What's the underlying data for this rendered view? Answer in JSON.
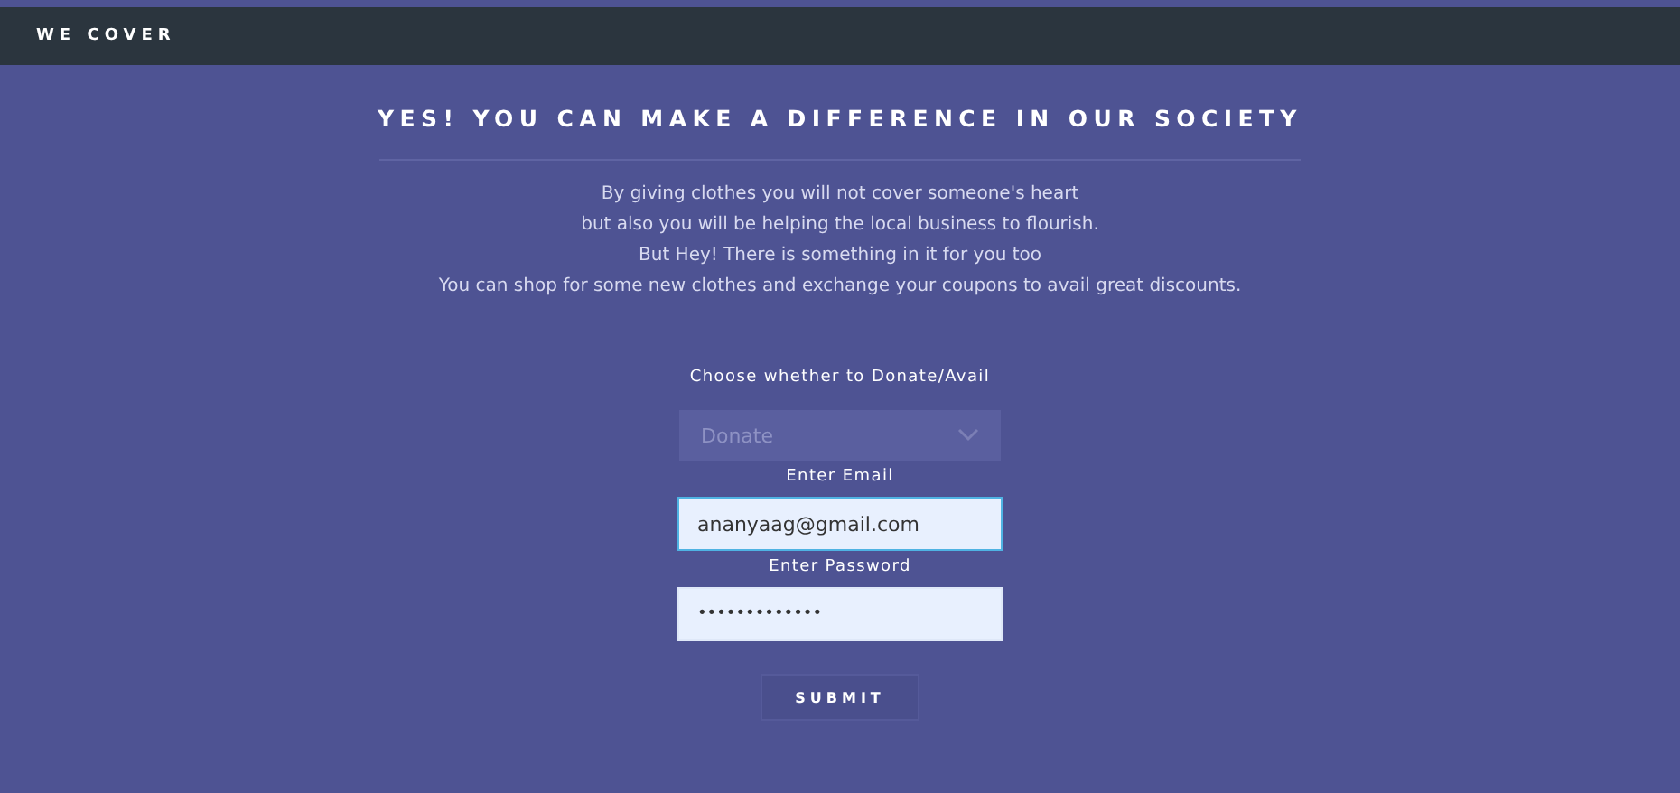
{
  "header": {
    "brand": "WE COVER"
  },
  "heading": "YES! YOU CAN MAKE A DIFFERENCE IN OUR SOCIETY",
  "intro": [
    "By giving clothes you will not cover someone's heart",
    "but also you will be helping the local business to flourish.",
    "But Hey! There is something in it for you too",
    "You can shop for some new clothes and exchange your coupons to avail great discounts."
  ],
  "form": {
    "choice_label": "Choose whether to Donate/Avail",
    "choice": {
      "value": "Donate"
    },
    "email_label": "Enter Email",
    "email": {
      "value": "ananyaag@gmail.com",
      "focused": true
    },
    "password_label": "Enter Password",
    "password": {
      "value": "•••••••••••••",
      "focused": false
    },
    "submit": "SUBMIT"
  }
}
